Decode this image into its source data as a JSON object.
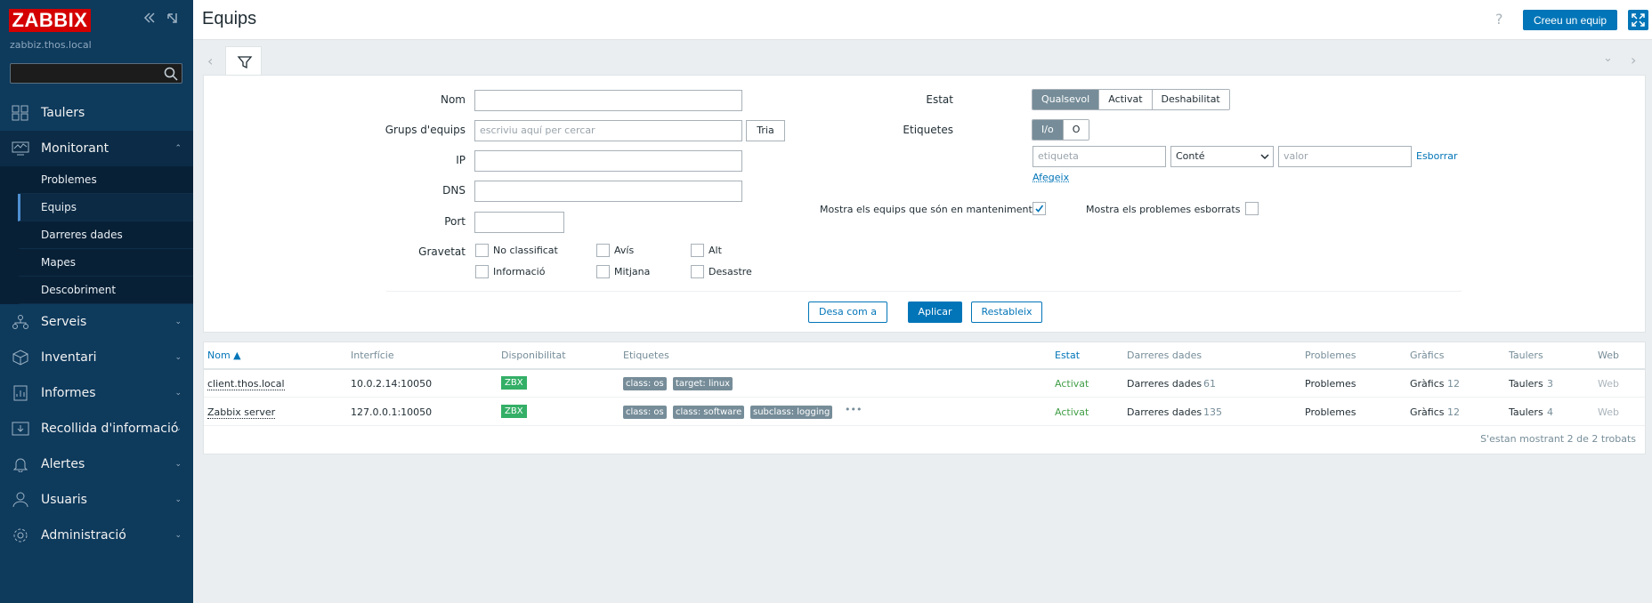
{
  "sidebar": {
    "logo": "ZABBIX",
    "server_name": "zabbiz.thos.local",
    "search_placeholder": "",
    "menu": [
      {
        "label": "Taulers",
        "icon": "dashboard-icon"
      },
      {
        "label": "Monitorant",
        "icon": "monitoring-icon",
        "open": true
      },
      {
        "label": "Serveis",
        "icon": "services-icon"
      },
      {
        "label": "Inventari",
        "icon": "inventory-icon"
      },
      {
        "label": "Informes",
        "icon": "reports-icon"
      },
      {
        "label": "Recollida d'informació",
        "icon": "data-collection-icon"
      },
      {
        "label": "Alertes",
        "icon": "bell-icon"
      },
      {
        "label": "Usuaris",
        "icon": "users-icon"
      },
      {
        "label": "Administració",
        "icon": "gear-icon"
      }
    ],
    "submenu": [
      "Problemes",
      "Equips",
      "Darreres dades",
      "Mapes",
      "Descobriment"
    ],
    "active_submenu": "Equips"
  },
  "header": {
    "title": "Equips",
    "help": "?",
    "create_button": "Creeu un equip"
  },
  "filter": {
    "name_label": "Nom",
    "name_value": "",
    "groups_label": "Grups d'equips",
    "groups_placeholder": "escriviu aquí per cercar",
    "select_button": "Tria",
    "ip_label": "IP",
    "dns_label": "DNS",
    "port_label": "Port",
    "severity_label": "Gravetat",
    "severities": [
      "No classificat",
      "Avís",
      "Alt",
      "Informació",
      "Mitjana",
      "Desastre"
    ],
    "status_label": "Estat",
    "status_options": [
      "Qualsevol",
      "Activat",
      "Deshabilitat"
    ],
    "status_selected": "Qualsevol",
    "tags_label": "Etiquetes",
    "tags_options": [
      "I/o",
      "O"
    ],
    "tags_selected": "I/o",
    "tag_placeholder": "etiqueta",
    "tag_operator": "Conté",
    "value_placeholder": "valor",
    "remove_link": "Esborrar",
    "add_link": "Afegeix",
    "maintenance_label": "Mostra els equips que són en manteniment",
    "maintenance_checked": true,
    "suppressed_label": "Mostra els problemes esborrats",
    "suppressed_checked": false,
    "save_as_button": "Desa com a",
    "apply_button": "Aplicar",
    "reset_button": "Restableix"
  },
  "table": {
    "columns": [
      "Nom ▲",
      "Interfície",
      "Disponibilitat",
      "Etiquetes",
      "Estat",
      "Darreres dades",
      "Problemes",
      "Gràfics",
      "Taulers",
      "Web"
    ],
    "rows": [
      {
        "name": "client.thos.local",
        "interface": "10.0.2.14:10050",
        "availability": "ZBX",
        "tags": [
          "class: os",
          "target: linux"
        ],
        "status": "Activat",
        "latest_data": "Darreres dades",
        "latest_count": "61",
        "problems": "Problemes",
        "graphs": "Gràfics",
        "graphs_count": "12",
        "dashboards": "Taulers",
        "dashboards_count": "3",
        "web": "Web"
      },
      {
        "name": "Zabbix server",
        "interface": "127.0.0.1:10050",
        "availability": "ZBX",
        "tags": [
          "class: os",
          "class: software",
          "subclass: logging"
        ],
        "more_tags": "•••",
        "status": "Activat",
        "latest_data": "Darreres dades",
        "latest_count": "135",
        "problems": "Problemes",
        "graphs": "Gràfics",
        "graphs_count": "12",
        "dashboards": "Taulers",
        "dashboards_count": "4",
        "web": "Web"
      }
    ],
    "footer": "S'estan mostrant 2 de 2 trobats"
  },
  "colors": {
    "sidebar_bg": "#0e3a5c",
    "accent": "#0275b8",
    "logo": "#d40000",
    "available": "#34af67",
    "enabled": "#429e47"
  }
}
